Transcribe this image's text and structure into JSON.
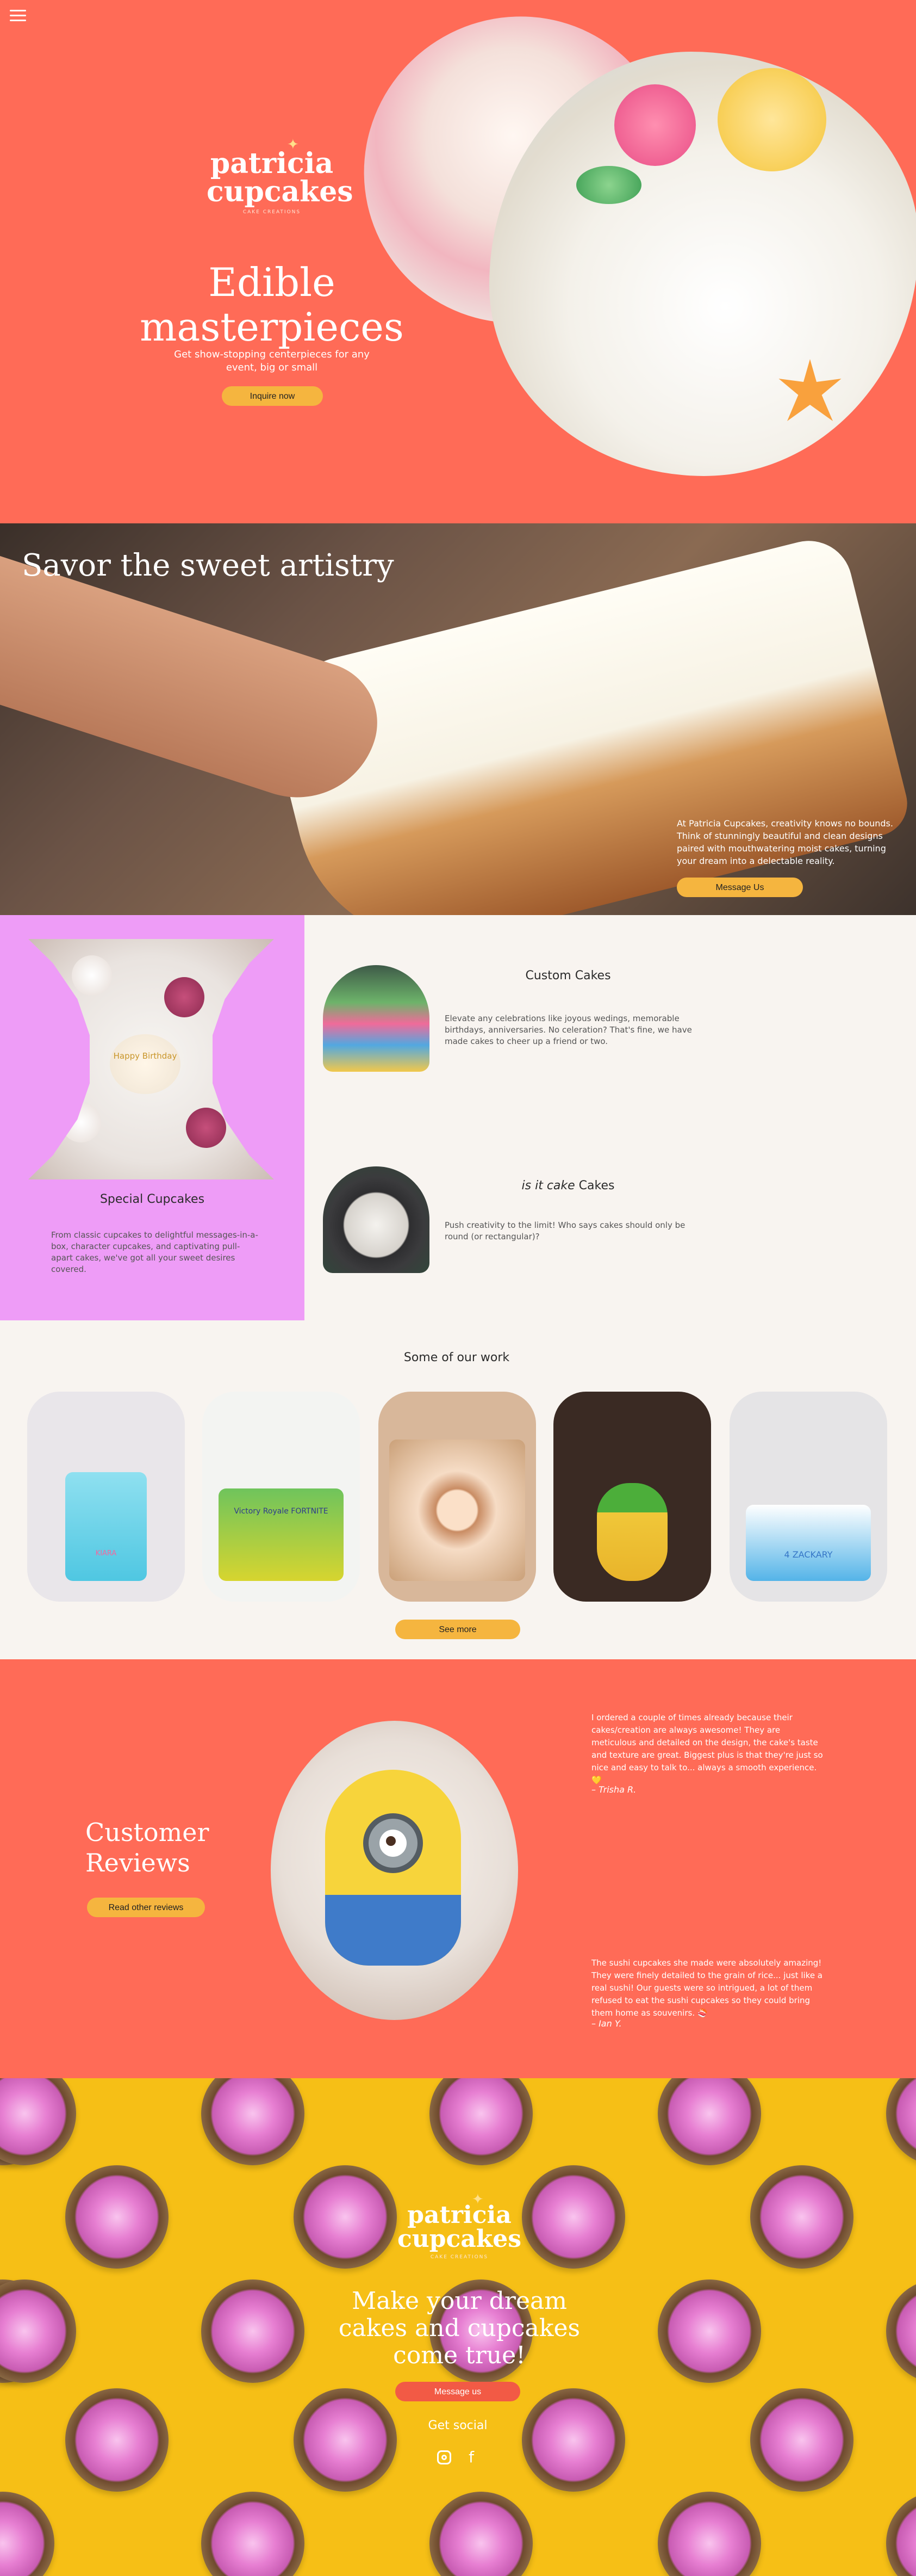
{
  "brand": {
    "logo_line1": "patricia",
    "logo_line2": "cupcakes",
    "logo_tagline": "CAKE CREATIONS"
  },
  "hero": {
    "title": "Edible masterpieces",
    "subtitle": "Get show-stopping centerpieces for any event, big or small",
    "cta_label": "Inquire now"
  },
  "savor": {
    "title": "Savor the sweet artistry",
    "text": "At Patricia Cupcakes, creativity knows no bounds. Think of stunningly beautiful and clean designs paired with mouthwatering moist cakes, turning your dream into a delectable reality.",
    "cta_label": "Message Us"
  },
  "special": {
    "title": "Special Cupcakes",
    "description": "From classic cupcakes to delightful messages-in-a-box, character cupcakes, and captivating pull-apart cakes, we've got all your sweet desires covered.",
    "cupcake_text": "Happy Birthday",
    "cards": [
      {
        "title": "Custom Cakes",
        "description": "Elevate any celebrations like joyous wedings, memorable birthdays, anniversaries. No celeration? That's fine, we have made cakes to cheer up a friend or two."
      },
      {
        "title_italic": "is it cake",
        "title_rest": " Cakes",
        "description": "Push creativity to the limit! Who says cakes should only be round (or rectangular)?"
      }
    ]
  },
  "work": {
    "title": "Some of our work",
    "cake_labels": [
      "KIARA",
      "Victory Royale FORTNITE",
      "",
      "",
      "4 ZACKARY"
    ],
    "cta_label": "See more"
  },
  "reviews": {
    "title_line1": "Customer",
    "title_line2": "Reviews",
    "cta_label": "Read other reviews",
    "items": [
      {
        "text": "I ordered a couple of times already because their cakes/creation are always awesome! They are meticulous and detailed on the design, the cake's taste and texture are great. Biggest plus is that they're just so nice and easy to talk to... always a smooth experience. 💛",
        "author": "– Trisha R."
      },
      {
        "text": "The sushi cupcakes she made were absolutely amazing! They were finely detailed to the grain of rice... just like a real sushi! Our guests were so intrigued, a lot of them refused to eat the sushi cupcakes so they could bring them home as souvenirs. 🍣",
        "author": "– Ian Y."
      }
    ]
  },
  "footer": {
    "title": "Make your dream cakes and cupcakes come true!",
    "cta_label": "Message us",
    "social_label": "Get social",
    "facebook_glyph": "f"
  },
  "colors": {
    "coral": "#ff6b57",
    "orange_button": "#f5b53f",
    "pink_panel": "#ee9cf7",
    "cream": "#f8f4f0",
    "yellow": "#f6bf16"
  }
}
